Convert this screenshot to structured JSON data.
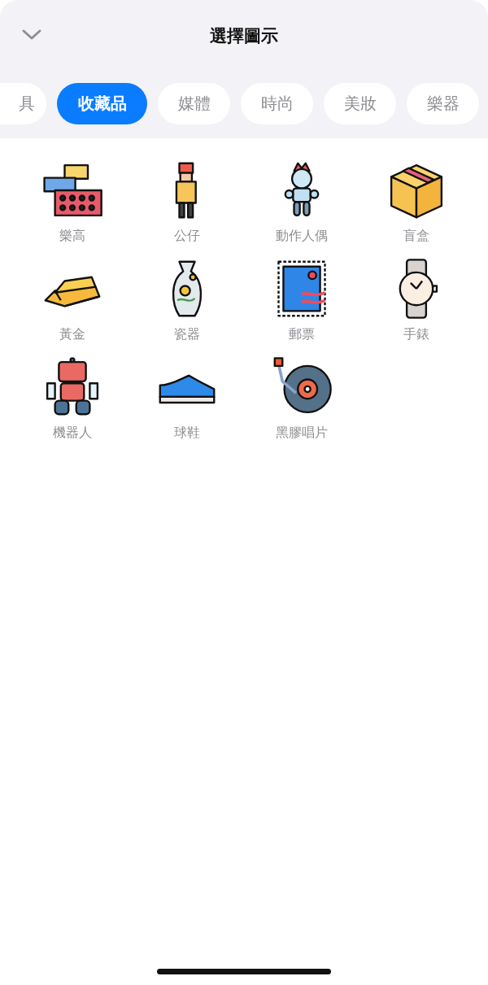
{
  "header": {
    "title": "選擇圖示"
  },
  "tabs": [
    {
      "label": "具",
      "selected": false
    },
    {
      "label": "收藏品",
      "selected": true
    },
    {
      "label": "媒體",
      "selected": false
    },
    {
      "label": "時尚",
      "selected": false
    },
    {
      "label": "美妝",
      "selected": false
    },
    {
      "label": "樂器",
      "selected": false
    }
  ],
  "icons": [
    {
      "label": "樂高"
    },
    {
      "label": "公仔"
    },
    {
      "label": "動作人偶"
    },
    {
      "label": "盲盒"
    },
    {
      "label": "黃金"
    },
    {
      "label": "瓷器"
    },
    {
      "label": "郵票"
    },
    {
      "label": "手錶"
    },
    {
      "label": "機器人"
    },
    {
      "label": "球鞋"
    },
    {
      "label": "黑膠唱片"
    }
  ]
}
